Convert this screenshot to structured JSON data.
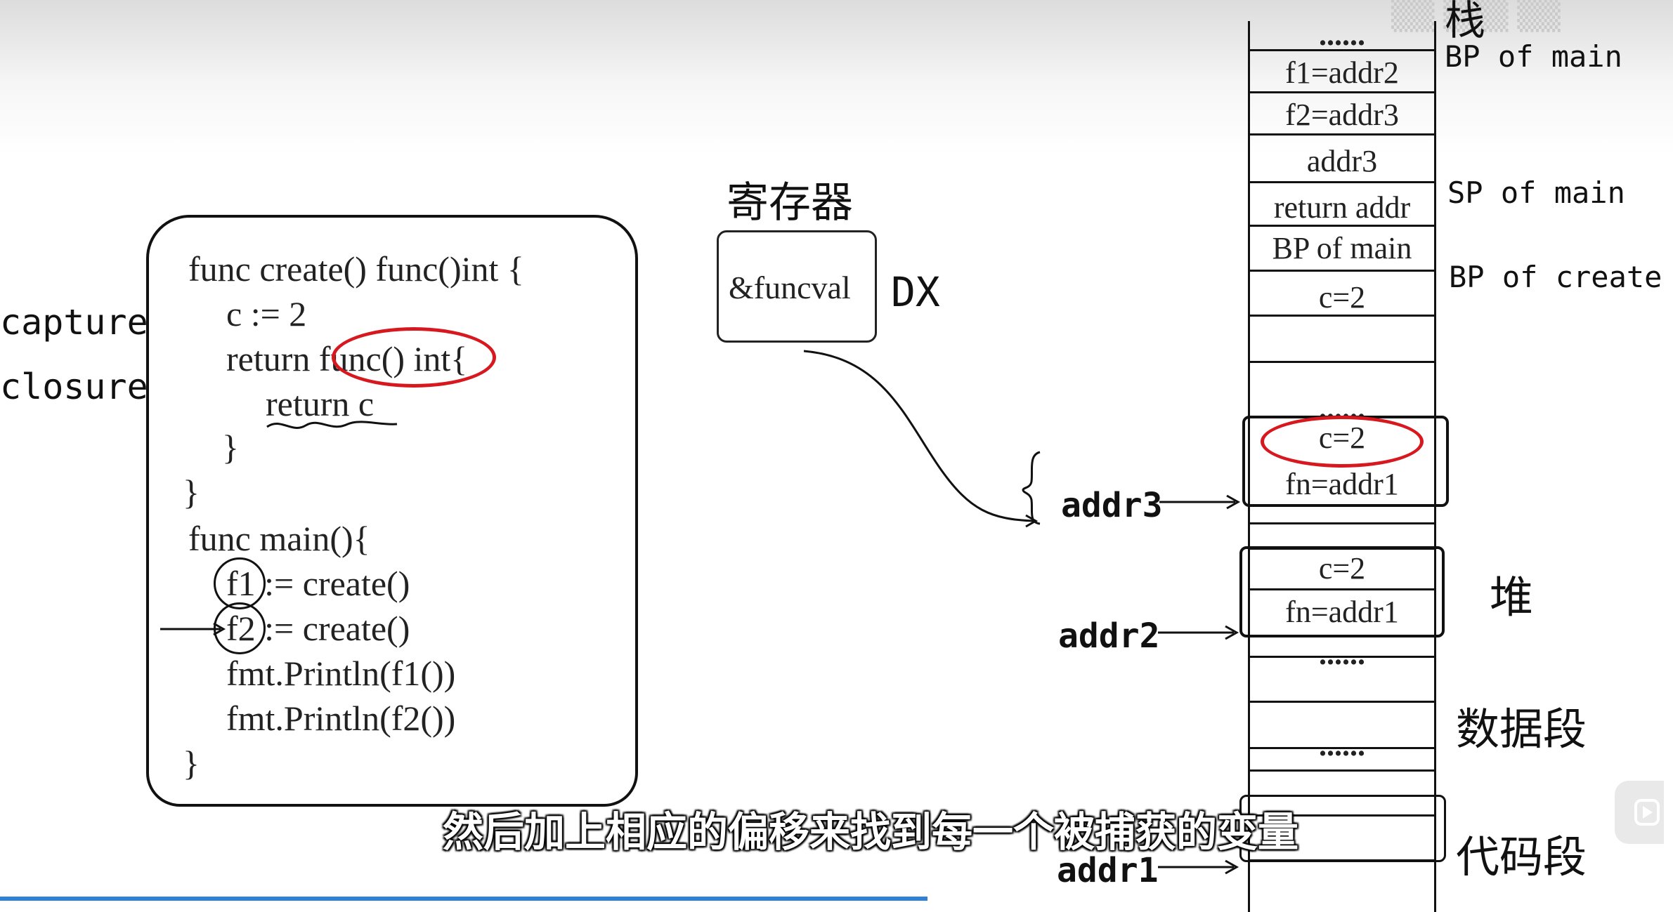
{
  "left_labels": [
    "capture",
    "closure"
  ],
  "code": {
    "lines": [
      "func create() func()int {",
      "c := 2",
      "return func() int{",
      "return c",
      "}",
      "}",
      "func main(){",
      "f1 := create()",
      "f2 := create()",
      "fmt.Println(f1())",
      "fmt.Println(f2())",
      "}"
    ]
  },
  "register": {
    "title": "寄存器",
    "value": "&funcval",
    "name": "DX"
  },
  "stack": {
    "title": "栈",
    "cells": [
      "......",
      "f1=addr2",
      "f2=addr3",
      "addr3",
      "return addr",
      "BP of main",
      "c=2",
      "",
      "......"
    ],
    "side_labels": [
      "BP of main",
      "SP of main",
      "BP of create"
    ]
  },
  "heap": {
    "label": "堆",
    "object1": {
      "c": "c=2",
      "fn": "fn=addr1"
    },
    "object2": {
      "c": "c=2",
      "fn": "fn=addr1"
    },
    "ellipsis": "......"
  },
  "data_segment": {
    "label": "数据段",
    "ellipsis": "......"
  },
  "code_segment": {
    "label": "代码段"
  },
  "pointers": [
    "addr3",
    "addr2",
    "addr1"
  ],
  "subtitle": "然后加上相应的偏移来找到每一个被捕获的变量",
  "colors": {
    "highlight": "#d7191f",
    "progress": "#2f80d9"
  }
}
